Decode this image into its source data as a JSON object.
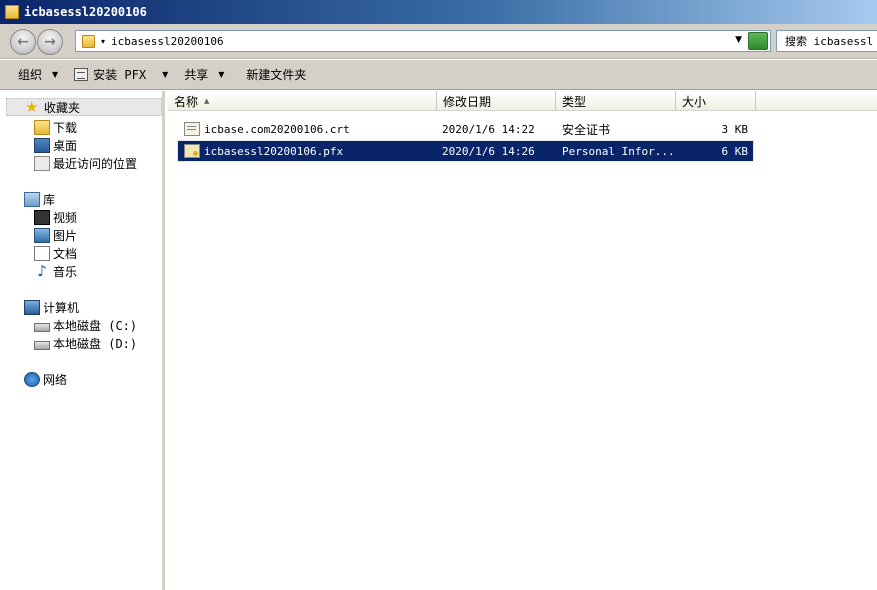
{
  "window": {
    "title": "icbasessl20200106"
  },
  "address": {
    "path": "icbasessl20200106",
    "search_placeholder": "搜索 icbasessl"
  },
  "toolbar": {
    "organize": "组织",
    "install_pfx": "安装 PFX",
    "share": "共享",
    "new_folder": "新建文件夹"
  },
  "nav": {
    "favorites": "收藏夹",
    "downloads": "下载",
    "desktop": "桌面",
    "recent": "最近访问的位置",
    "libraries": "库",
    "videos": "视频",
    "pictures": "图片",
    "documents": "文档",
    "music": "音乐",
    "computer": "计算机",
    "drive_c": "本地磁盘 (C:)",
    "drive_d": "本地磁盘 (D:)",
    "network": "网络"
  },
  "columns": {
    "name": "名称",
    "modified": "修改日期",
    "type": "类型",
    "size": "大小"
  },
  "files": [
    {
      "name": "icbase.com20200106.crt",
      "modified": "2020/1/6 14:22",
      "type": "安全证书",
      "size": "3 KB",
      "icon": "certificate-icon"
    },
    {
      "name": "icbasessl20200106.pfx",
      "modified": "2020/1/6 14:26",
      "type": "Personal Infor...",
      "size": "6 KB",
      "icon": "pfx-key-icon"
    }
  ],
  "colors": {
    "titlebar": "#0a246a",
    "selection": "#0a246a",
    "chrome": "#d4d0c8"
  }
}
